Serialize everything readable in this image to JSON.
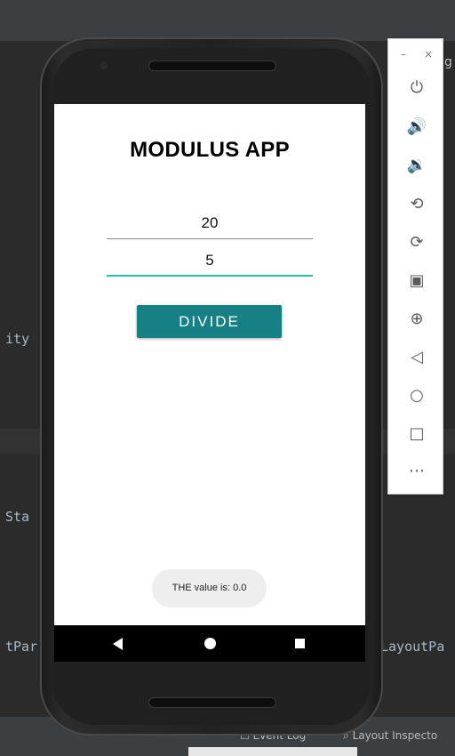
{
  "ide": {
    "code_fragments": [
      "ity",
      "Sta",
      "tPar",
      "LayoutPa"
    ],
    "top_right_fragment": "g",
    "status_bar": {
      "event_log": "Event Log",
      "layout_inspector": "Layout Inspecto"
    }
  },
  "app": {
    "title": "MODULUS APP",
    "input_first": "20",
    "input_second": "5",
    "divide_button": "DIVIDE",
    "toast": "THE value is: 0.0"
  },
  "emulator_toolbar": {
    "window_controls": [
      "–",
      "×"
    ],
    "buttons": [
      "power-icon",
      "volume-up-icon",
      "volume-down-icon",
      "rotate-left-icon",
      "rotate-right-icon",
      "screenshot-icon",
      "zoom-icon",
      "back-icon",
      "home-icon",
      "overview-icon",
      "more-icon"
    ]
  },
  "colors": {
    "accent": "#178084",
    "focus_underline": "#26bdb0"
  }
}
